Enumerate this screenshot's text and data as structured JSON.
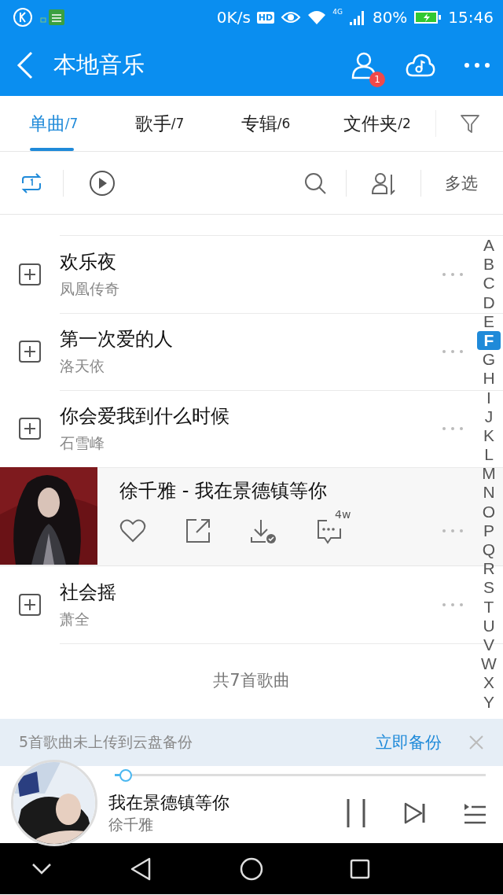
{
  "status_bar": {
    "speed": "0K/s",
    "hd": "HD",
    "network": "4G",
    "battery": "80%",
    "time": "15:46"
  },
  "header": {
    "title": "本地音乐",
    "badge": "1"
  },
  "tabs": [
    {
      "label": "单曲",
      "count": "/7",
      "selected": true
    },
    {
      "label": "歌手",
      "count": "/7",
      "selected": false
    },
    {
      "label": "专辑",
      "count": "/6",
      "selected": false
    },
    {
      "label": "文件夹",
      "count": "/2",
      "selected": false
    }
  ],
  "toolbar": {
    "multi_select": "多选"
  },
  "songs": [
    {
      "kind": "song",
      "title": "欢乐夜",
      "artist": "凤凰传奇"
    },
    {
      "kind": "song",
      "title": "第一次爱的人",
      "artist": "洛天依"
    },
    {
      "kind": "song",
      "title": "你会爱我到什么时候",
      "artist": "石雪峰"
    },
    {
      "kind": "expanded",
      "title": "徐千雅 - 我在景德镇等你",
      "comment_count": "4w"
    },
    {
      "kind": "song",
      "title": "社会摇",
      "artist": "萧全"
    }
  ],
  "footer": "共7首歌曲",
  "index": [
    {
      "letter": "A",
      "selected": false
    },
    {
      "letter": "B",
      "selected": false
    },
    {
      "letter": "C",
      "selected": false
    },
    {
      "letter": "D",
      "selected": false
    },
    {
      "letter": "E",
      "selected": false
    },
    {
      "letter": "F",
      "selected": true
    },
    {
      "letter": "G",
      "selected": false
    },
    {
      "letter": "H",
      "selected": false
    },
    {
      "letter": "I",
      "selected": false
    },
    {
      "letter": "J",
      "selected": false
    },
    {
      "letter": "K",
      "selected": false
    },
    {
      "letter": "L",
      "selected": false
    },
    {
      "letter": "M",
      "selected": false
    },
    {
      "letter": "N",
      "selected": false
    },
    {
      "letter": "O",
      "selected": false
    },
    {
      "letter": "P",
      "selected": false
    },
    {
      "letter": "Q",
      "selected": false
    },
    {
      "letter": "R",
      "selected": false
    },
    {
      "letter": "S",
      "selected": false
    },
    {
      "letter": "T",
      "selected": false
    },
    {
      "letter": "U",
      "selected": false
    },
    {
      "letter": "V",
      "selected": false
    },
    {
      "letter": "W",
      "selected": false
    },
    {
      "letter": "X",
      "selected": false
    },
    {
      "letter": "Y",
      "selected": false
    }
  ],
  "banner": {
    "message": "5首歌曲未上传到云盘备份",
    "action": "立即备份"
  },
  "player": {
    "title": "我在景德镇等你",
    "artist": "徐千雅",
    "level": 0.03
  }
}
